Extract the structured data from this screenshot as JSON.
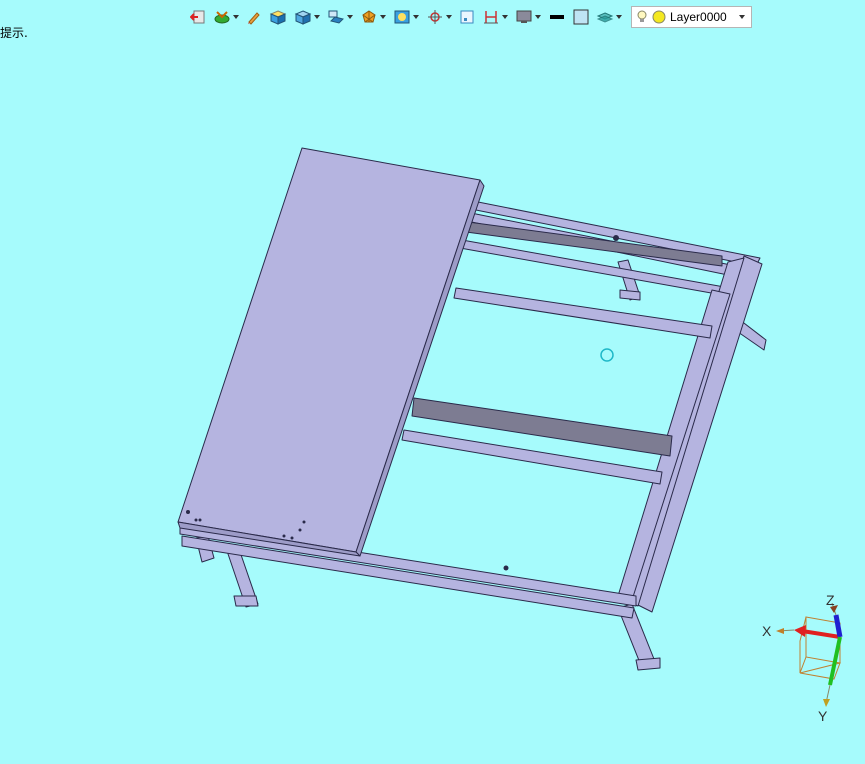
{
  "hint": {
    "text": "提示."
  },
  "toolbar": {
    "tools": [
      {
        "icon": "exit-sketch-icon"
      },
      {
        "icon": "render-style-icon"
      },
      {
        "icon": "brush-icon"
      },
      {
        "icon": "shaded-box-icon"
      },
      {
        "icon": "box-view-icon"
      },
      {
        "icon": "multi-view-icon"
      },
      {
        "icon": "sphere-icon"
      },
      {
        "icon": "spotlight-icon"
      },
      {
        "icon": "target-icon"
      },
      {
        "icon": "frame-icon"
      },
      {
        "icon": "dimension-icon"
      },
      {
        "icon": "monitor-icon"
      },
      {
        "icon": "line-weight-icon"
      },
      {
        "icon": "fill-color-icon"
      },
      {
        "icon": "layer-stack-icon"
      }
    ],
    "layer": {
      "value": "Layer0000"
    }
  },
  "colors": {
    "background": "#a6fbfc",
    "model_fill": "#b5b4e0",
    "model_edge": "#2a2a4a",
    "axis_x": "#e02020",
    "axis_y": "#20c020",
    "axis_z": "#2020d0"
  },
  "axis_triad": {
    "x_label": "X",
    "y_label": "Y",
    "z_label": "Z"
  }
}
